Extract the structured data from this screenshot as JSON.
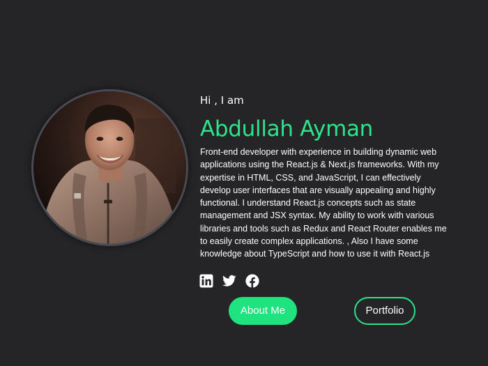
{
  "hero": {
    "greeting": "Hi , I am",
    "name": "Abdullah Ayman",
    "bio": "Front-end developer with experience in building dynamic web applications using the React.js & Next.js frameworks. With my expertise in HTML, CSS, and JavaScript, I can effectively develop user interfaces that are visually appealing and highly functional. I understand React.js concepts such as state management and JSX syntax. My ability to work with various libraries and tools such as Redux and React Router enables me to easily create complex applications. , Also I have some knowledge about TypeScript and how to use it with React.js"
  },
  "social_links": [
    {
      "icon": "linkedin-icon"
    },
    {
      "icon": "twitter-icon"
    },
    {
      "icon": "facebook-icon"
    }
  ],
  "buttons": {
    "primary_label": "About Me",
    "secondary_label": "Portfolio"
  },
  "colors": {
    "background": "#252527",
    "accent": "#2ee48a",
    "primary_button": "#1ee37f",
    "text": "#ffffff"
  }
}
